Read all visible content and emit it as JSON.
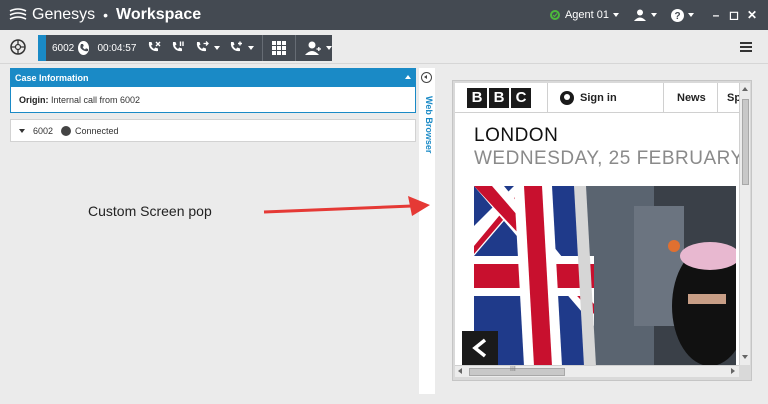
{
  "titlebar": {
    "brand": "Genesys",
    "separator": "•",
    "app_title": "Workspace",
    "agent_label": "Agent 01",
    "agent_status_color": "#4cba3c",
    "win_minimize": "–",
    "win_restore": "◻",
    "win_close": "✕"
  },
  "toolbar": {
    "call_number": "6002",
    "call_timer": "00:04:57",
    "accent_color": "#1a8ac6",
    "icons": [
      "end-call-icon",
      "hold-call-icon",
      "transfer-call-icon",
      "conference-call-icon",
      "dialpad-icon",
      "consult-agent-icon"
    ]
  },
  "case_info": {
    "header": "Case Information",
    "origin_label": "Origin:",
    "origin_value": "Internal call from 6002"
  },
  "call_row": {
    "number": "6002",
    "status": "Connected"
  },
  "side_tab": {
    "label": "Web Browser"
  },
  "annotation": {
    "text": "Custom Screen pop",
    "arrow_color": "#e53935"
  },
  "browser": {
    "logo_letters": [
      "B",
      "B",
      "C"
    ],
    "signin": "Sign in",
    "nav_news": "News",
    "nav_partial": "Sp",
    "city": "LONDON",
    "date": "WEDNESDAY, 25 FEBRUARY",
    "back_glyph": "<",
    "scroll_grip": "III"
  }
}
